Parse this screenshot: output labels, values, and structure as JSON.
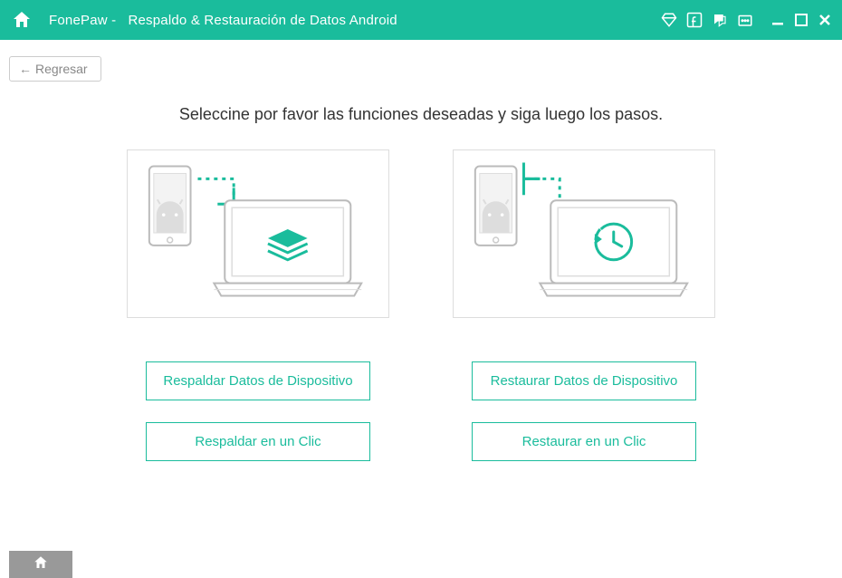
{
  "colors": {
    "accent": "#1abc9c",
    "gray": "#999"
  },
  "titlebar": {
    "app_name": "FonePaw",
    "module": "Respaldo & Restauración de Datos Android"
  },
  "back_label": "Regresar",
  "instruction": "Seleccine por favor las funciones deseadas y siga luego los pasos.",
  "backup": {
    "device_btn": "Respaldar Datos de Dispositivo",
    "one_click_btn": "Respaldar en un Clic"
  },
  "restore": {
    "device_btn": "Restaurar Datos de Dispositivo",
    "one_click_btn": "Restaurar en un Clic"
  }
}
